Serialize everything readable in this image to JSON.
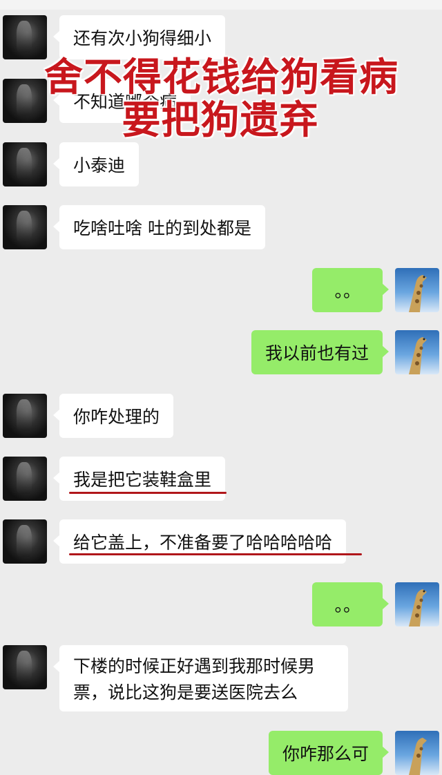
{
  "overlay": {
    "line1": "舍不得花钱给狗看病",
    "line2": "要把狗遗弃"
  },
  "messages": [
    {
      "side": "left",
      "text": "还有次小狗得细小"
    },
    {
      "side": "left",
      "text": "不知道哪个病"
    },
    {
      "side": "left",
      "text": "小泰迪"
    },
    {
      "side": "left",
      "text": "吃啥吐啥 吐的到处都是"
    },
    {
      "side": "right",
      "text": "。。"
    },
    {
      "side": "right",
      "text": "我以前也有过"
    },
    {
      "side": "left",
      "text": "你咋处理的"
    },
    {
      "side": "left",
      "text": "我是把它装鞋盒里"
    },
    {
      "side": "left",
      "text": "给它盖上，不准备要了哈哈哈哈哈"
    },
    {
      "side": "right",
      "text": "。。"
    },
    {
      "side": "left",
      "text": "下楼的时候正好遇到我那时候男票，说比这狗是要送医院去么"
    },
    {
      "side": "right",
      "text": "你咋那么可"
    }
  ],
  "colors": {
    "bubble_right": "#95ec69",
    "bubble_left": "#ffffff",
    "underline": "#b0161a",
    "overlay": "#c8171d"
  },
  "avatar_icons": {
    "left": "dark-photo-avatar",
    "right": "giraffe-avatar"
  }
}
